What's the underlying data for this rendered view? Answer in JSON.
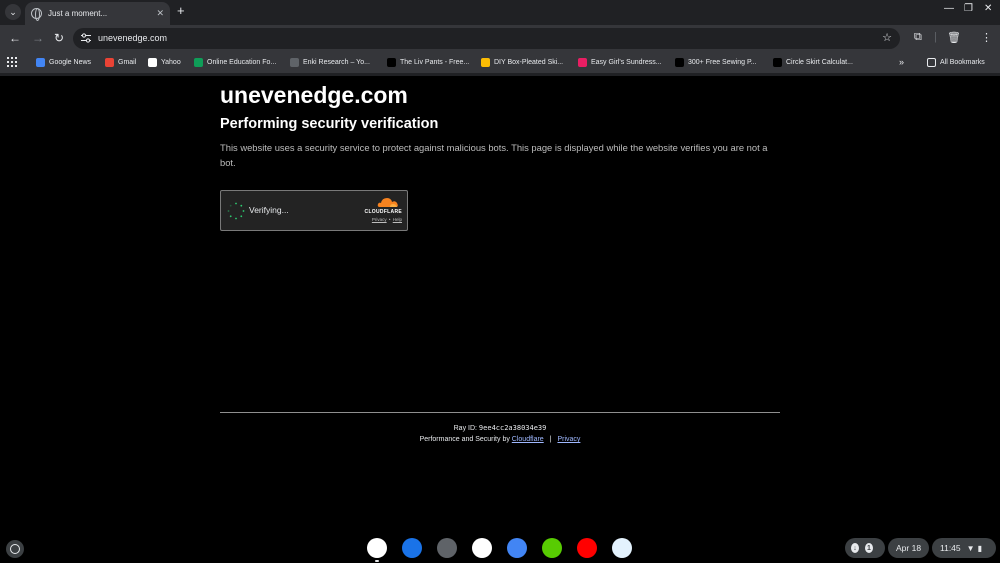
{
  "window": {
    "tab_title": "Just a moment...",
    "new_tab_glyph": "+",
    "tab_close_glyph": "✕"
  },
  "toolbar": {
    "url": "unevenedge.com"
  },
  "bookmarks": {
    "items": [
      {
        "label": "Google News",
        "icon": "google-news-icon",
        "color": "#4285f4"
      },
      {
        "label": "Gmail",
        "icon": "gmail-icon",
        "color": "#ea4335"
      },
      {
        "label": "Yahoo",
        "icon": "yahoo-icon",
        "color": "#ffffff"
      },
      {
        "label": "Online Education Fo...",
        "icon": "education-icon",
        "color": "#0f9d58"
      },
      {
        "label": "Enki Research – Yo...",
        "icon": "enki-icon",
        "color": "#5f6368"
      },
      {
        "label": "The Liv Pants - Free...",
        "icon": "pattern-icon",
        "color": "#000000"
      },
      {
        "label": "DIY Box-Pleated Ski...",
        "icon": "diy-icon",
        "color": "#fbbc04"
      },
      {
        "label": "Easy Girl's Sundress...",
        "icon": "s-icon",
        "color": "#e91e63"
      },
      {
        "label": "300+ Free Sewing P...",
        "icon": "pattern-icon",
        "color": "#000000"
      },
      {
        "label": "Circle Skirt Calculat...",
        "icon": "pattern-icon",
        "color": "#000000"
      }
    ],
    "overflow": "»",
    "all_bookmarks": "All Bookmarks"
  },
  "page": {
    "site_title": "unevenedge.com",
    "heading": "Performing security verification",
    "description": "This website uses a security service to protect against malicious bots. This page is displayed while the website verifies you are not a bot.",
    "widget": {
      "status": "Verifying...",
      "brand": "CLOUDFLARE",
      "privacy": "Privacy",
      "separator": "•",
      "help": "Help"
    },
    "footer": {
      "ray_label": "Ray ID:",
      "ray_id": "9ee4cc2a38034e39",
      "perf_prefix": "Performance and Security by",
      "cloudflare_link": "Cloudflare",
      "pipe": "|",
      "privacy_link": "Privacy"
    }
  },
  "shelf": {
    "apps": [
      {
        "name": "chrome-icon",
        "color": "#ffffff"
      },
      {
        "name": "files-icon",
        "color": "#1a73e8"
      },
      {
        "name": "settings-icon",
        "color": "#5f6368"
      },
      {
        "name": "calendar-icon",
        "color": "#ffffff"
      },
      {
        "name": "docs-icon",
        "color": "#4285f4"
      },
      {
        "name": "duolingo-icon",
        "color": "#58cc02"
      },
      {
        "name": "youtube-icon",
        "color": "#ff0000"
      },
      {
        "name": "web-app-icon",
        "color": "#e3f2fd"
      }
    ],
    "notification_count": "1",
    "date": "Apr 18",
    "time": "11:45"
  }
}
